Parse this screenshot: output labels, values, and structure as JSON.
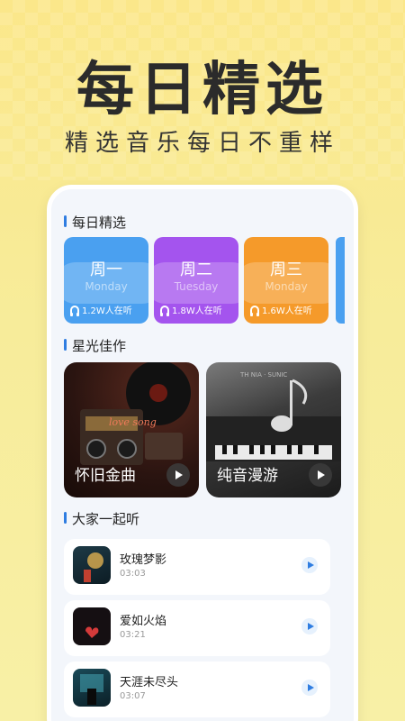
{
  "hero": {
    "title": "每日精选",
    "subtitle": "精选音乐每日不重样"
  },
  "sections": {
    "daily": "每日精选",
    "starlight": "星光佳作",
    "together": "大家一起听"
  },
  "daily_cards": [
    {
      "name": "周一",
      "en": "Monday",
      "listeners": "1.2W人在听",
      "color": "#4aa0f0"
    },
    {
      "name": "周二",
      "en": "Tuesday",
      "listeners": "1.8W人在听",
      "color": "#a454ee"
    },
    {
      "name": "周三",
      "en": "Monday",
      "listeners": "1.6W人在听",
      "color": "#f59a2a"
    }
  ],
  "features": [
    {
      "label": "怀旧金曲",
      "icon": "play-icon"
    },
    {
      "label": "纯音漫游",
      "icon": "play-icon"
    }
  ],
  "songs": [
    {
      "title": "玫瑰梦影",
      "time": "03:03"
    },
    {
      "title": "爱如火焰",
      "time": "03:21"
    },
    {
      "title": "天涯未尽头",
      "time": "03:07"
    }
  ],
  "icons": {
    "listeners": "headphones-icon",
    "play": "play-icon"
  },
  "colors": {
    "accent": "#2f7de1",
    "background": "#f8ec9c"
  }
}
